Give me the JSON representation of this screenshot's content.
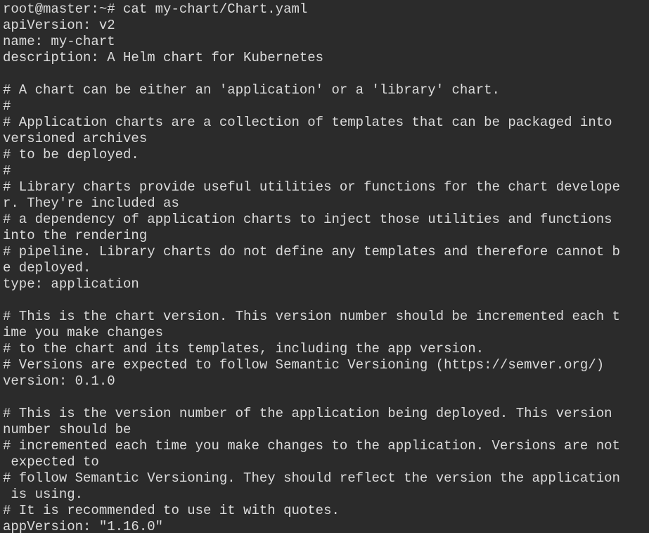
{
  "terminal": {
    "partial_top_line": "  -  - -",
    "lines": [
      "root@master:~# cat my-chart/Chart.yaml",
      "apiVersion: v2",
      "name: my-chart",
      "description: A Helm chart for Kubernetes",
      "",
      "# A chart can be either an 'application' or a 'library' chart.",
      "#",
      "# Application charts are a collection of templates that can be packaged into",
      "versioned archives",
      "# to be deployed.",
      "#",
      "# Library charts provide useful utilities or functions for the chart develope",
      "r. They're included as",
      "# a dependency of application charts to inject those utilities and functions",
      "into the rendering",
      "# pipeline. Library charts do not define any templates and therefore cannot b",
      "e deployed.",
      "type: application",
      "",
      "# This is the chart version. This version number should be incremented each t",
      "ime you make changes",
      "# to the chart and its templates, including the app version.",
      "# Versions are expected to follow Semantic Versioning (https://semver.org/)",
      "version: 0.1.0",
      "",
      "# This is the version number of the application being deployed. This version",
      "number should be",
      "# incremented each time you make changes to the application. Versions are not",
      " expected to",
      "# follow Semantic Versioning. They should reflect the version the application",
      " is using.",
      "# It is recommended to use it with quotes.",
      "appVersion: \"1.16.0\""
    ]
  }
}
